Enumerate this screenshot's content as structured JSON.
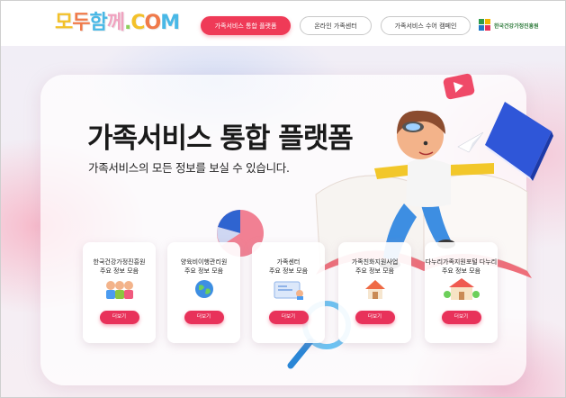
{
  "header": {
    "logo_text": "모두함께.COM",
    "nav": [
      {
        "label": "가족서비스 통합 플랫폼",
        "active": true
      },
      {
        "label": "온라인 가족센터",
        "active": false
      },
      {
        "label": "가족서비스 수어 캠페인",
        "active": false
      }
    ],
    "partner_label": "한국건강가정진흥원"
  },
  "hero": {
    "title": "가족서비스 통합 플랫폼",
    "subtitle": "가족서비스의 모든 정보를 보실 수 있습니다."
  },
  "services": [
    {
      "line1": "한국건강가정진흥원",
      "line2": "주요 정보 모음",
      "icon": "family-icon",
      "button": "더보기"
    },
    {
      "line1": "양육비이행관리원",
      "line2": "주요 정보 모음",
      "icon": "globe-icon",
      "button": "더보기"
    },
    {
      "line1": "가족센터",
      "line2": "주요 정보 모음",
      "icon": "info-board-icon",
      "button": "더보기"
    },
    {
      "line1": "가족친화지원사업",
      "line2": "주요 정보 모음",
      "icon": "house-icon",
      "button": "더보기"
    },
    {
      "line1": "다누리가족지원포털 다누리",
      "line2": "주요 정보 모음",
      "icon": "school-icon",
      "button": "더보기"
    }
  ],
  "colors": {
    "accent": "#ef3a57",
    "button": "#e8325a",
    "partner_green": "#2d7a3a"
  }
}
